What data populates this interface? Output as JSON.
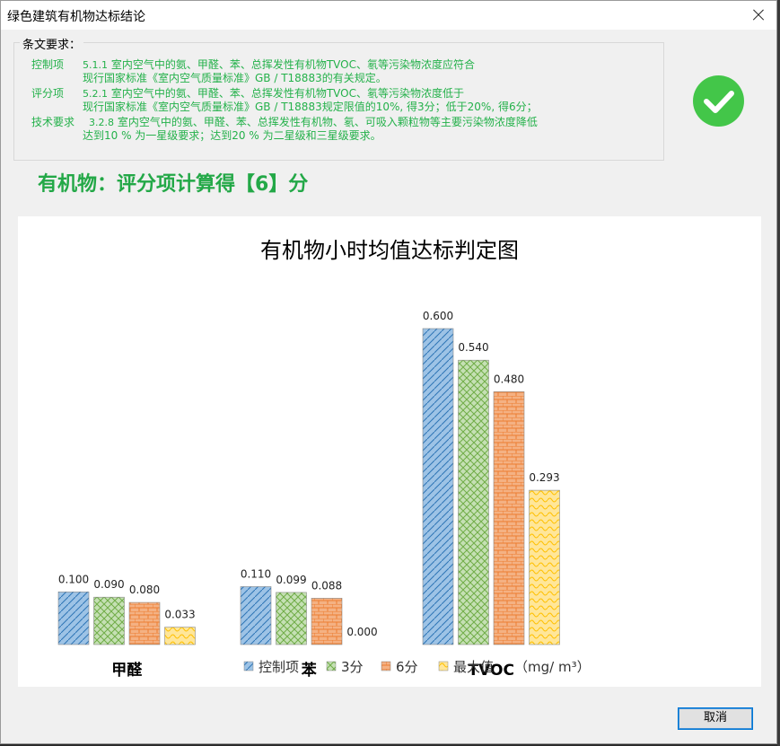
{
  "window": {
    "title": "绿色建筑有机物达标结论"
  },
  "requirements": {
    "group_label": "条文要求：",
    "items": [
      {
        "key": "控制项",
        "num": "5.1.1",
        "lines": [
          "室内空气中的氨、甲醛、苯、总挥发性有机物TVOC、氡等污染物浓度应符合",
          "现行国家标准《室内空气质量标准》GB / T18883的有关规定。"
        ]
      },
      {
        "key": "评分项",
        "num": "5.2.1",
        "lines": [
          "室内空气中的氨、甲醛、苯、总挥发性有机物TVOC、氡等污染物浓度低于",
          "现行国家标准《室内空气质量标准》GB / T18883规定限值的10%, 得3分；低于20%, 得6分；"
        ]
      },
      {
        "key": "技术要求",
        "num": "3.2.8",
        "lines": [
          "室内空气中的氨、甲醛、苯、总挥发性有机物、氡、可吸入颗粒物等主要污染物浓度降低",
          "达到10 % 为一星级要求；达到20 % 为二星级和三星级要求。"
        ]
      }
    ]
  },
  "status": {
    "icon": "check-circle-icon",
    "color": "#43c649"
  },
  "score_text": "有机物：评分项计算得【6】分",
  "chart_data": {
    "type": "bar",
    "title": "有机物小时均值达标判定图",
    "categories": [
      "甲醛",
      "苯",
      "TVOC"
    ],
    "series": [
      {
        "name": "控制项",
        "values": [
          0.1,
          0.11,
          0.6
        ],
        "labels": [
          "0.100",
          "0.110",
          "0.600"
        ],
        "color": "#9dc3e6",
        "pattern": "diag"
      },
      {
        "name": "3分",
        "values": [
          0.09,
          0.099,
          0.54
        ],
        "labels": [
          "0.090",
          "0.099",
          "0.540"
        ],
        "color": "#a9d18e",
        "pattern": "cross"
      },
      {
        "name": "6分",
        "values": [
          0.08,
          0.088,
          0.48
        ],
        "labels": [
          "0.080",
          "0.088",
          "0.480"
        ],
        "color": "#f4b183",
        "pattern": "brick"
      },
      {
        "name": "最大值",
        "values": [
          0.033,
          0.0,
          0.293
        ],
        "labels": [
          "0.033",
          "0.000",
          "0.293"
        ],
        "color": "#ffe699",
        "pattern": "wave"
      }
    ],
    "unit_label": "（mg/  m³）",
    "ylim": [
      0,
      0.6
    ],
    "grid": false,
    "legend_position": "bottom"
  },
  "buttons": {
    "cancel": "取消"
  }
}
